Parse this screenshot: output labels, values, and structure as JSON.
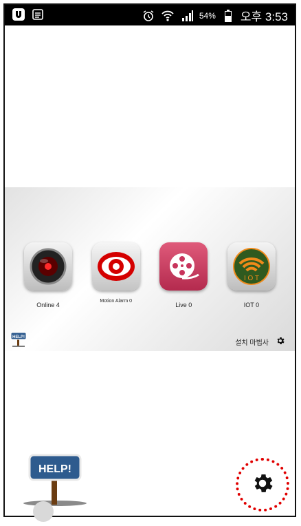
{
  "statusbar": {
    "battery": "54%",
    "time": "오후 3:53"
  },
  "tiles": [
    {
      "label": "Online 4",
      "icon": "camera-lens-icon"
    },
    {
      "label": "Motion Alarm 0",
      "icon": "eye-icon"
    },
    {
      "label": "Live 0",
      "icon": "film-reel-icon"
    },
    {
      "label": "IOT 0",
      "icon": "iot-wifi-icon"
    }
  ],
  "setup": {
    "label": "설치 마법사"
  },
  "help": {
    "small_text": "HELP!",
    "big_text": "HELP!"
  },
  "colors": {
    "accent_red": "#d40000",
    "live_pink": "#c8345c",
    "iot_green": "#2f5a1f",
    "iot_orange": "#f08a1a"
  }
}
